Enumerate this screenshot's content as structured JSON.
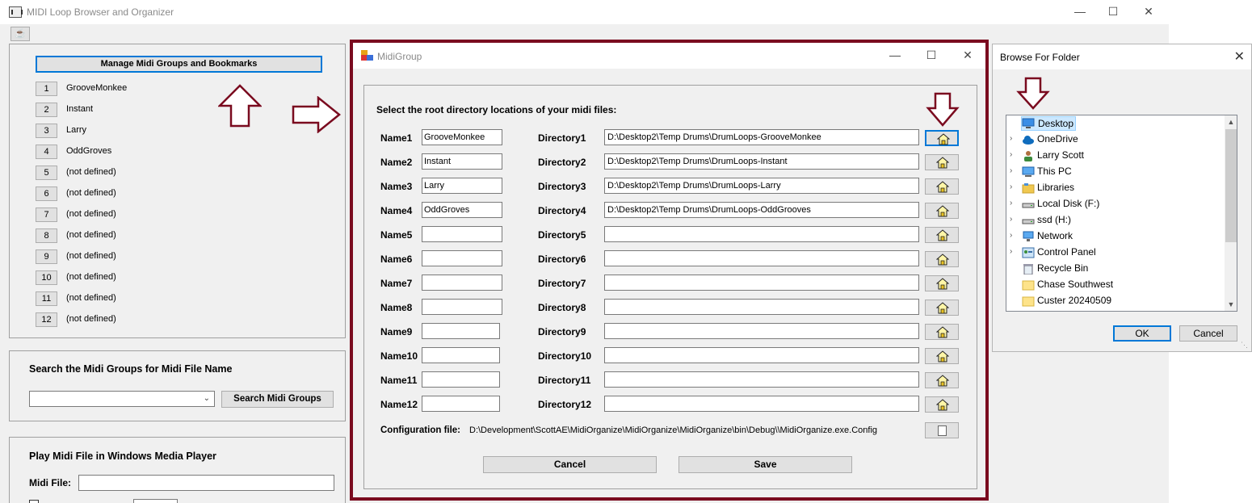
{
  "main_window": {
    "title": "MIDI Loop Browser and Organizer",
    "minimize": "—",
    "maximize": "☐",
    "close": "✕",
    "toolbar_icon": "☕"
  },
  "groups_panel": {
    "manage_button": "Manage Midi Groups and Bookmarks",
    "groups": [
      {
        "num": "1",
        "name": "GrooveMonkee"
      },
      {
        "num": "2",
        "name": "Instant"
      },
      {
        "num": "3",
        "name": "Larry"
      },
      {
        "num": "4",
        "name": "OddGroves"
      },
      {
        "num": "5",
        "name": "(not defined)"
      },
      {
        "num": "6",
        "name": "(not defined)"
      },
      {
        "num": "7",
        "name": "(not defined)"
      },
      {
        "num": "8",
        "name": "(not defined)"
      },
      {
        "num": "9",
        "name": "(not defined)"
      },
      {
        "num": "10",
        "name": "(not defined)"
      },
      {
        "num": "11",
        "name": "(not defined)"
      },
      {
        "num": "12",
        "name": "(not defined)"
      }
    ]
  },
  "search_panel": {
    "title": "Search the Midi Groups for Midi File Name",
    "combo_value": "",
    "button": "Search Midi  Groups"
  },
  "play_panel": {
    "title": "Play Midi File in Windows Media Player",
    "midi_file_label": "Midi File:",
    "midi_file_value": ""
  },
  "midi_group_dialog": {
    "title": "MidiGroup",
    "minimize": "—",
    "maximize": "☐",
    "close": "✕",
    "heading": "Select the root directory locations of your midi files:",
    "rows": [
      {
        "name_label": "Name1",
        "name": "GrooveMonkee",
        "dir_label": "Directory1",
        "dir": "D:\\Desktop2\\Temp Drums\\DrumLoops-GrooveMonkee"
      },
      {
        "name_label": "Name2",
        "name": "Instant",
        "dir_label": "Directory2",
        "dir": "D:\\Desktop2\\Temp Drums\\DrumLoops-Instant"
      },
      {
        "name_label": "Name3",
        "name": "Larry",
        "dir_label": "Directory3",
        "dir": "D:\\Desktop2\\Temp Drums\\DrumLoops-Larry"
      },
      {
        "name_label": "Name4",
        "name": "OddGroves",
        "dir_label": "Directory4",
        "dir": "D:\\Desktop2\\Temp Drums\\DrumLoops-OddGrooves"
      },
      {
        "name_label": "Name5",
        "name": "",
        "dir_label": "Directory5",
        "dir": ""
      },
      {
        "name_label": "Name6",
        "name": "",
        "dir_label": "Directory6",
        "dir": ""
      },
      {
        "name_label": "Name7",
        "name": "",
        "dir_label": "Directory7",
        "dir": ""
      },
      {
        "name_label": "Name8",
        "name": "",
        "dir_label": "Directory8",
        "dir": ""
      },
      {
        "name_label": "Name9",
        "name": "",
        "dir_label": "Directory9",
        "dir": ""
      },
      {
        "name_label": "Name10",
        "name": "",
        "dir_label": "Directory10",
        "dir": ""
      },
      {
        "name_label": "Name11",
        "name": "",
        "dir_label": "Directory11",
        "dir": ""
      },
      {
        "name_label": "Name12",
        "name": "",
        "dir_label": "Directory12",
        "dir": ""
      }
    ],
    "config_label": "Configuration file:",
    "config_path": "D:\\Development\\ScottAE\\MidiOrganize\\MidiOrganize\\MidiOrganize\\bin\\Debug\\\\MidiOrganize.exe.Config",
    "cancel_button": "Cancel",
    "save_button": "Save"
  },
  "browse_folder_dialog": {
    "title": "Browse For Folder",
    "close": "✕",
    "tree": [
      {
        "label": "Desktop",
        "icon": "desktop-icon",
        "selected": true,
        "expandable": false
      },
      {
        "label": "OneDrive",
        "icon": "cloud-icon",
        "selected": false,
        "expandable": true
      },
      {
        "label": "Larry Scott",
        "icon": "user-icon",
        "selected": false,
        "expandable": true
      },
      {
        "label": "This PC",
        "icon": "computer-icon",
        "selected": false,
        "expandable": true
      },
      {
        "label": "Libraries",
        "icon": "libraries-icon",
        "selected": false,
        "expandable": true
      },
      {
        "label": "Local Disk (F:)",
        "icon": "drive-icon",
        "selected": false,
        "expandable": true
      },
      {
        "label": "ssd (H:)",
        "icon": "drive-icon",
        "selected": false,
        "expandable": true
      },
      {
        "label": "Network",
        "icon": "network-icon",
        "selected": false,
        "expandable": true
      },
      {
        "label": "Control Panel",
        "icon": "control-panel-icon",
        "selected": false,
        "expandable": true
      },
      {
        "label": "Recycle Bin",
        "icon": "recycle-bin-icon",
        "selected": false,
        "expandable": false
      },
      {
        "label": "Chase Southwest",
        "icon": "folder-icon",
        "selected": false,
        "expandable": false
      },
      {
        "label": "Custer 20240509",
        "icon": "folder-icon",
        "selected": false,
        "expandable": false
      }
    ],
    "ok_button": "OK",
    "cancel_button": "Cancel"
  },
  "colors": {
    "highlight_frame": "#7a0b1f",
    "annotation_arrow": "#7a0b1f",
    "focus_blue": "#0078d7"
  }
}
